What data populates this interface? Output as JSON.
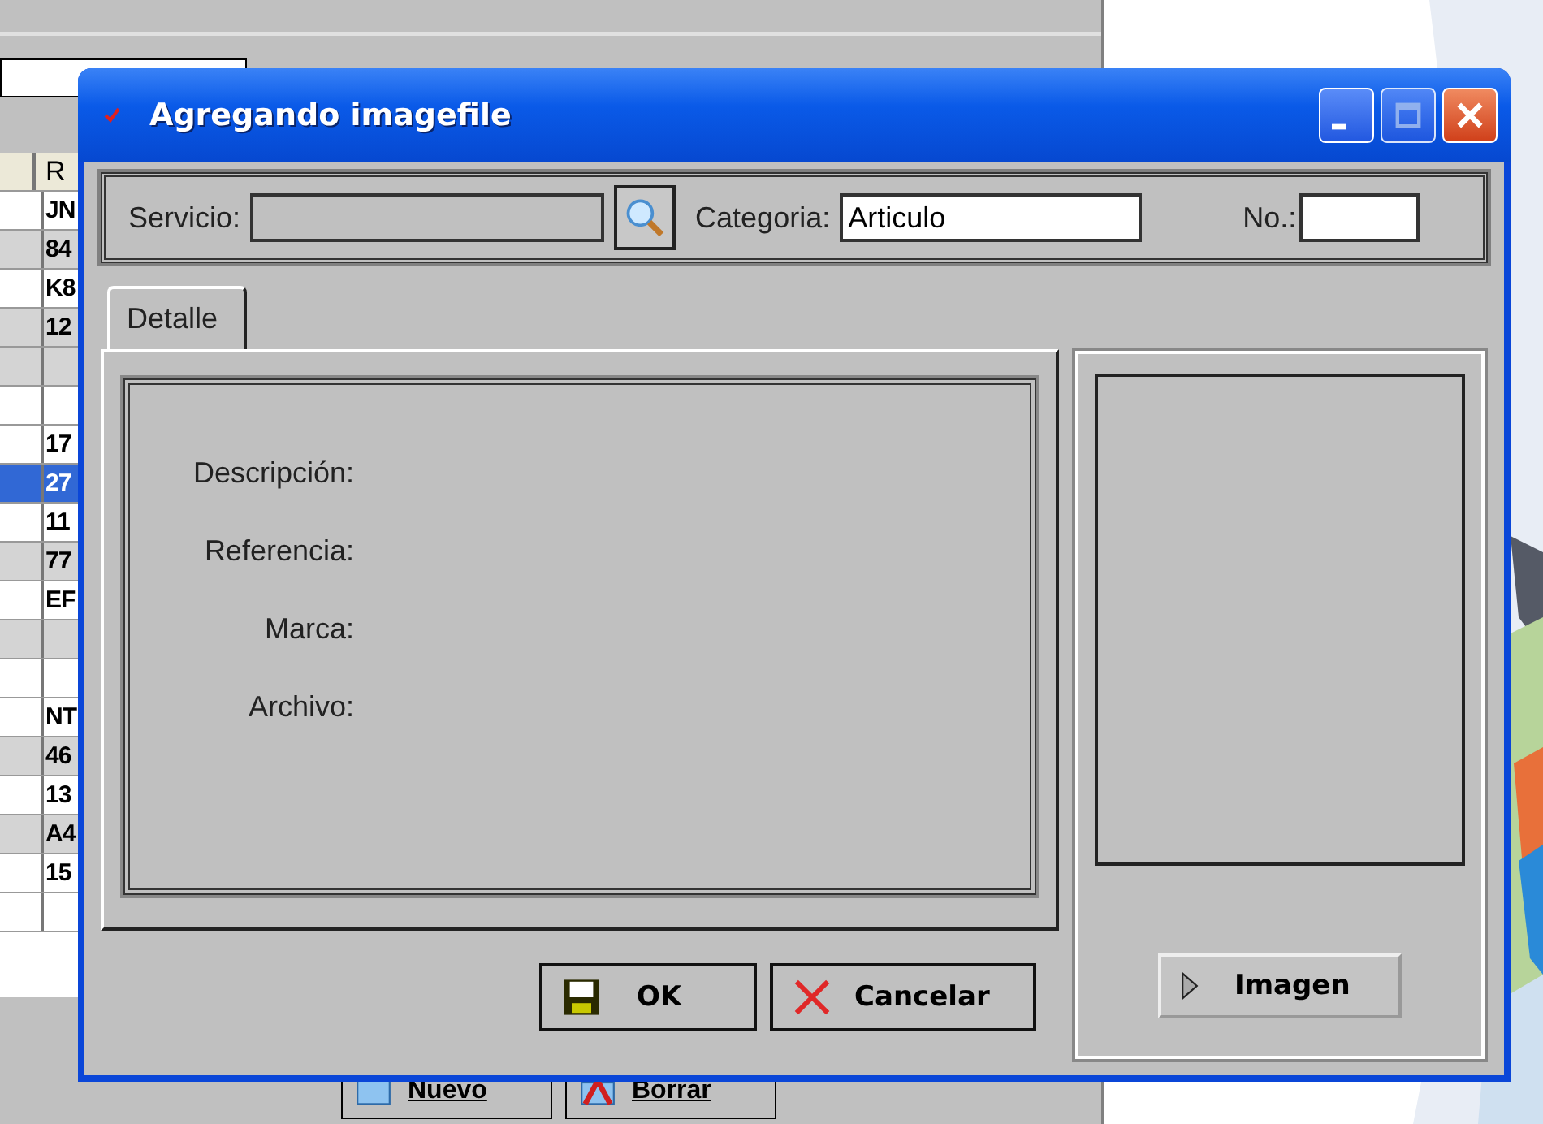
{
  "background_window": {
    "table": {
      "columns": [
        "R"
      ],
      "row_groups": [
        [
          {
            "cell": "JN",
            "selected": false
          },
          {
            "cell": "84",
            "selected": false
          },
          {
            "cell": "K8",
            "selected": false
          },
          {
            "cell": "12",
            "selected": false
          }
        ],
        [
          {
            "cell": "17",
            "selected": false
          },
          {
            "cell": "27",
            "selected": true
          },
          {
            "cell": "11",
            "selected": false
          },
          {
            "cell": "77",
            "selected": false
          },
          {
            "cell": "EF",
            "selected": false
          }
        ],
        [
          {
            "cell": "NT",
            "selected": false
          },
          {
            "cell": "46",
            "selected": false
          },
          {
            "cell": "13",
            "selected": false
          },
          {
            "cell": "A4",
            "selected": false
          },
          {
            "cell": "15",
            "selected": false
          }
        ]
      ]
    },
    "buttons": [
      {
        "label": "Nuevo",
        "kind": "new"
      },
      {
        "label": "Borrar",
        "kind": "delete"
      }
    ]
  },
  "dialog": {
    "title": "Agregando imagefile",
    "header_fields": [
      {
        "label": "Servicio:",
        "kind": "lookup"
      },
      {
        "label": "Categoria:",
        "value": "Articulo",
        "kind": "text"
      },
      {
        "label": "No.:",
        "kind": "short"
      }
    ],
    "tabs": [
      {
        "label": "Detalle",
        "selected": true
      }
    ],
    "detail_labels": [
      "Descripción:",
      "Referencia:",
      "Marca:",
      "Archivo:"
    ],
    "buttons": [
      {
        "label": "OK",
        "kind": "save"
      },
      {
        "label": "Cancelar",
        "kind": "cancel"
      }
    ],
    "image_button": {
      "label": "Imagen"
    }
  }
}
